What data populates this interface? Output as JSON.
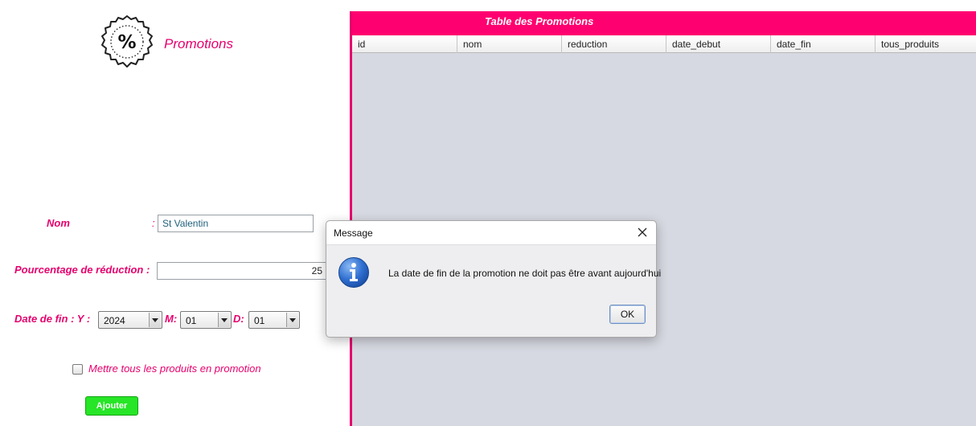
{
  "form": {
    "title": "Promotions",
    "logo_icon": "percent-badge-icon",
    "nom_label": "Nom",
    "nom_colon": ":",
    "nom_value": "St Valentin",
    "pct_label": "Pourcentage de réduction :",
    "pct_value": "25",
    "date_label": "Date de fin  : Y :",
    "month_label": "M:",
    "day_label": "D:",
    "year_value": "2024",
    "month_value": "01",
    "day_value": "01",
    "all_products_label": "Mettre tous les produits en promotion",
    "add_button_label": "Ajouter"
  },
  "table": {
    "title": "Table des  Promotions",
    "columns": [
      "id",
      "nom",
      "reduction",
      "date_debut",
      "date_fin",
      "tous_produits"
    ],
    "rows": []
  },
  "dialog": {
    "title": "Message",
    "close_icon": "close-icon",
    "info_icon": "info-icon",
    "message": "La date de fin de la promotion ne doit pas être avant aujourd'hui",
    "ok_label": "OK"
  },
  "colors": {
    "accent_pink": "#ff0070",
    "label_pink": "#e6006e",
    "add_button_green": "#27e527",
    "table_background": "#d7d9e2",
    "info_icon_blue": "#1f5fc2"
  }
}
